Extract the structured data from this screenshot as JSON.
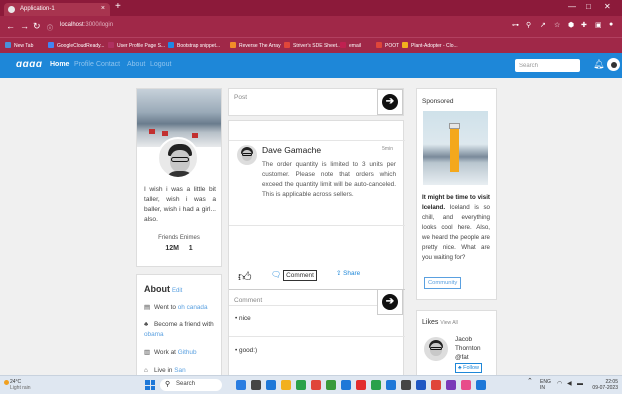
{
  "browser": {
    "tab_title": "Application-1",
    "tab_close": "×",
    "new_tab": "+",
    "url_host": "localhost",
    "url_path": ":3000/login",
    "win_min": "—",
    "win_max": "□",
    "win_close": "✕",
    "bookmarks": [
      {
        "label": "New Tab",
        "color": "#4a90d9"
      },
      {
        "label": "GoogleCloudReady...",
        "color": "#4285f4"
      },
      {
        "label": "User Profile Page S...",
        "color": "#b03060"
      },
      {
        "label": "Bootstrap snippet...",
        "color": "#1e88e5"
      },
      {
        "label": "Reverse The Array",
        "color": "#f28c28"
      },
      {
        "label": "Striver's SDE Sheet...",
        "color": "#e0463a"
      },
      {
        "label": "email",
        "color": "#c02050"
      },
      {
        "label": "POOT",
        "color": "#e0463a"
      },
      {
        "label": "Plant-Adopter - Clo...",
        "color": "#f2b01e"
      }
    ]
  },
  "navbar": {
    "brand": "ɑɑɑɑ",
    "links": [
      "Home",
      "Profile",
      "Contact",
      "About",
      "Logout"
    ],
    "search_placeholder": "Search",
    "bell_icon": "bell-icon"
  },
  "profile": {
    "bio": "I wish i was a little bit taller, wish i was a baller, wish i had a girl... also.",
    "stats_label": "Friends Enimes",
    "friends": "12M",
    "enemies": "1"
  },
  "about": {
    "title": "About",
    "edit": "Edit",
    "items": [
      {
        "icon": "▤",
        "text": "Went to ",
        "link": "oh canada"
      },
      {
        "icon": "♣",
        "text": "Become a friend with ",
        "link": "obama"
      },
      {
        "icon": "▥",
        "text": "Work at ",
        "link": "Github"
      },
      {
        "icon": "⌂",
        "text": "Live in ",
        "link": "San"
      }
    ]
  },
  "composer": {
    "placeholder": "Post"
  },
  "feed_post": {
    "author": "Dave Gamache",
    "time": "5min",
    "text": "The order quantity is limited to 3 units per customer. Please note that orders which exceed the quantity limit will be auto-canceled. This is applicable across sellers.",
    "comment_label": "Comment",
    "share_label": "Share"
  },
  "comments": {
    "placeholder": "Comment",
    "items": [
      "nice",
      "good:)"
    ]
  },
  "sponsored": {
    "title": "Sponsored",
    "headline": "It might be time to visit Iceland.",
    "text": " Iceland is so chill, and everything looks cool here. Also, we heard the people are pretty nice. What are you waiting for?",
    "button": "Community"
  },
  "likes": {
    "title": "Likes",
    "view_all": "View All",
    "person_first": "Jacob",
    "person_last": "Thornton",
    "handle": "@fat",
    "follow": "Follow"
  },
  "taskbar": {
    "weather_temp": "24°C",
    "weather_desc": "Light rain",
    "search": "Search",
    "lang": "ENG",
    "lang_sub": "IN",
    "time": "22:05",
    "date": "09-07-2023",
    "apps": [
      "#2a7de1",
      "#444",
      "#1e78d8",
      "#f2b01e",
      "#2aa14a",
      "#e0463a",
      "#3a9a3a",
      "#1e78d8",
      "#e22d2d",
      "#2aa14a",
      "#1e78d8",
      "#444",
      "#1f57c3",
      "#e0463a",
      "#7a3ab8",
      "#e84c8a",
      "#1e78d8"
    ]
  }
}
